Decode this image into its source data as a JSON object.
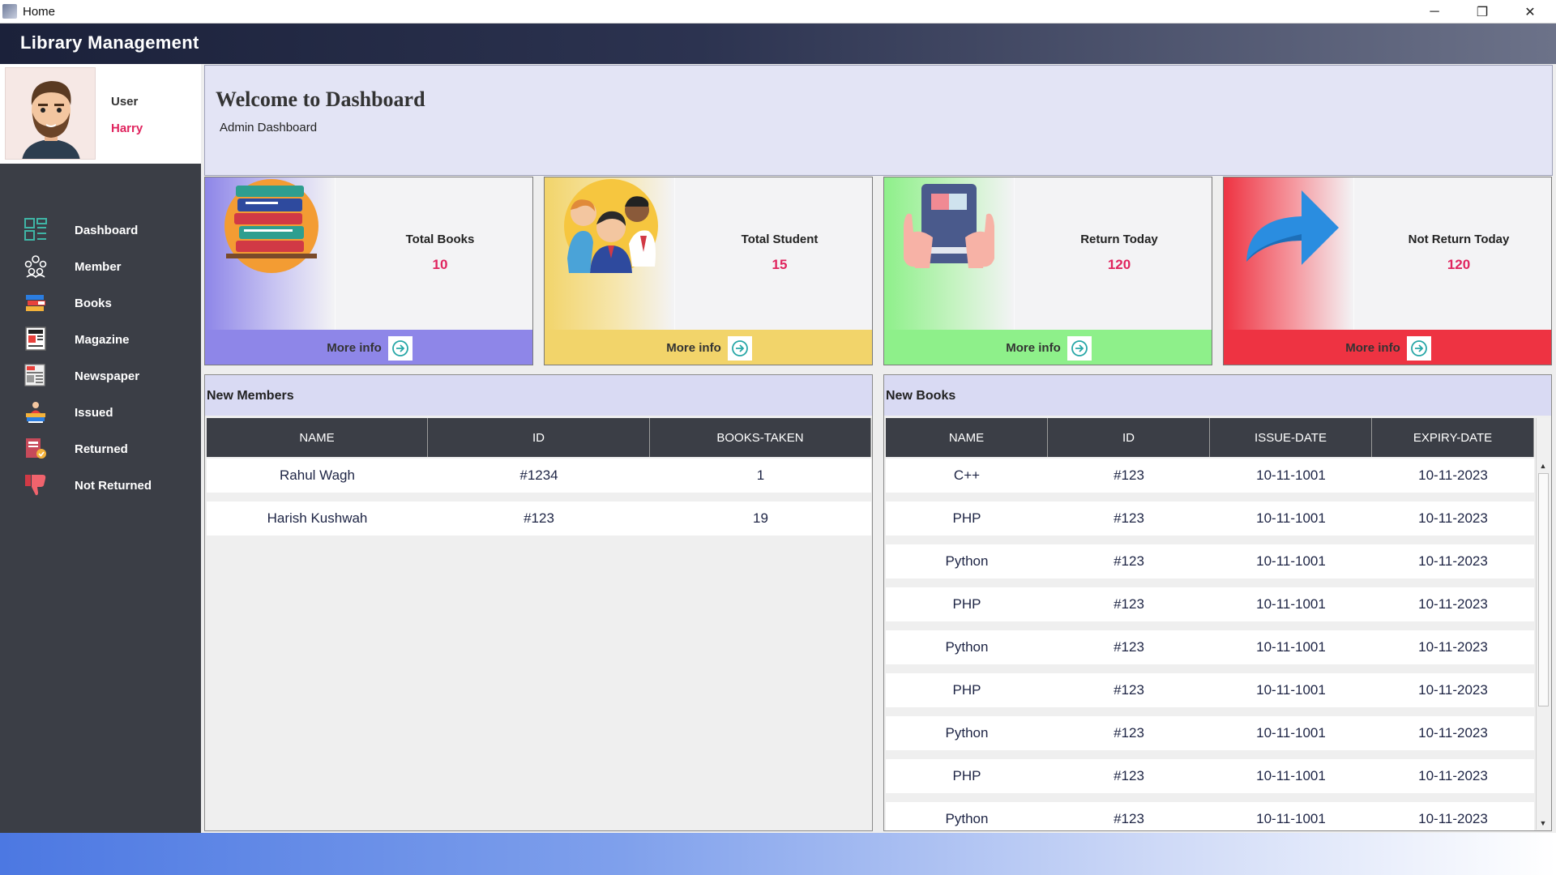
{
  "window": {
    "title": "Home",
    "minimize": "─",
    "maximize": "❐",
    "close": "✕"
  },
  "app": {
    "brand": "Library Management"
  },
  "profile": {
    "label": "User",
    "name": "Harry"
  },
  "nav": [
    {
      "label": "Dashboard",
      "icon": "dashboard-icon"
    },
    {
      "label": "Member",
      "icon": "members-icon"
    },
    {
      "label": "Books",
      "icon": "books-icon"
    },
    {
      "label": "Magazine",
      "icon": "magazine-icon"
    },
    {
      "label": "Newspaper",
      "icon": "newspaper-icon"
    },
    {
      "label": "Issued",
      "icon": "issued-icon"
    },
    {
      "label": "Returned",
      "icon": "returned-icon"
    },
    {
      "label": "Not Returned",
      "icon": "thumbs-down-icon"
    }
  ],
  "welcome": {
    "heading": "Welcome to Dashboard",
    "sub": "Admin Dashboard"
  },
  "cards": [
    {
      "title": "Total Books",
      "value": "10",
      "more": "More info",
      "footer_color": "#8e86e8",
      "accent": "#8e86e8"
    },
    {
      "title": "Total Student",
      "value": "15",
      "more": "More info",
      "footer_color": "#f2d46a",
      "accent": "#f2d46a"
    },
    {
      "title": "Return Today",
      "value": "120",
      "more": "More info",
      "footer_color": "#8ef08a",
      "accent": "#8ef08a"
    },
    {
      "title": "Not Return Today",
      "value": "120",
      "more": "More info",
      "footer_color": "#ee3342",
      "accent": "#ee3342"
    }
  ],
  "members": {
    "title": "New Members",
    "columns": [
      "NAME",
      "ID",
      "BOOKS-TAKEN"
    ],
    "rows": [
      [
        "Rahul Wagh",
        "#1234",
        "1"
      ],
      [
        "Harish Kushwah",
        "#123",
        "19"
      ]
    ]
  },
  "books": {
    "title": "New Books",
    "columns": [
      "NAME",
      "ID",
      "ISSUE-DATE",
      "EXPIRY-DATE"
    ],
    "rows": [
      [
        "C++",
        "#123",
        "10-11-1001",
        "10-11-2023"
      ],
      [
        "PHP",
        "#123",
        "10-11-1001",
        "10-11-2023"
      ],
      [
        "Python",
        "#123",
        "10-11-1001",
        "10-11-2023"
      ],
      [
        "PHP",
        "#123",
        "10-11-1001",
        "10-11-2023"
      ],
      [
        "Python",
        "#123",
        "10-11-1001",
        "10-11-2023"
      ],
      [
        "PHP",
        "#123",
        "10-11-1001",
        "10-11-2023"
      ],
      [
        "Python",
        "#123",
        "10-11-1001",
        "10-11-2023"
      ],
      [
        "PHP",
        "#123",
        "10-11-1001",
        "10-11-2023"
      ],
      [
        "Python",
        "#123",
        "10-11-1001",
        "10-11-2023"
      ]
    ]
  }
}
